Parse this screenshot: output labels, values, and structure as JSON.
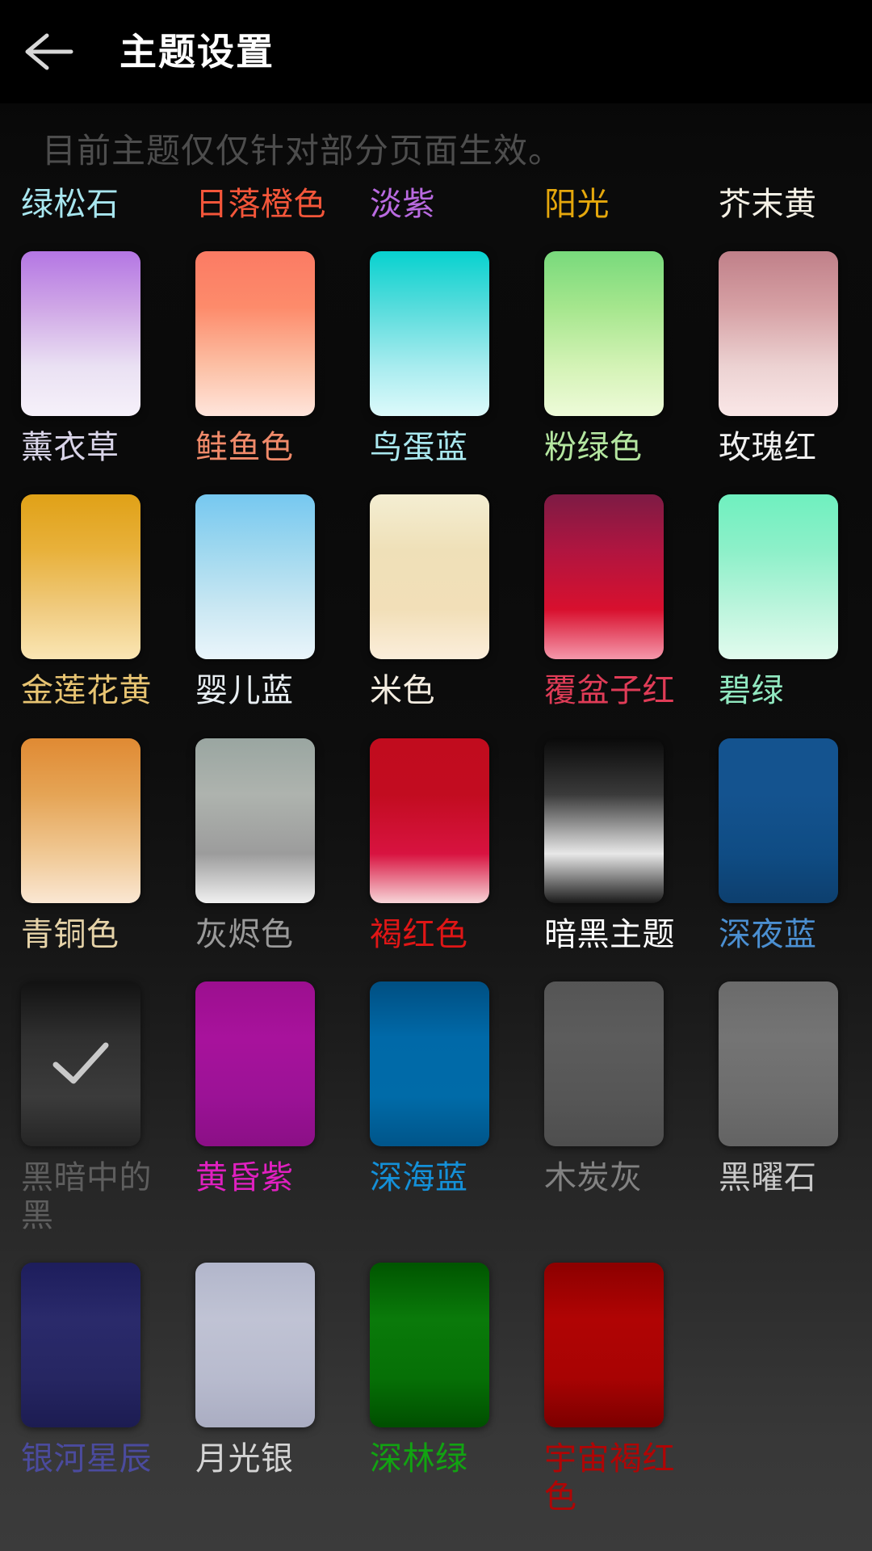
{
  "appbar": {
    "back_icon": "arrow-left-icon",
    "title": "主题设置"
  },
  "notice": "目前主题仅仅针对部分页面生效。",
  "selected_theme": "黑暗中的黑",
  "check_icon": "check-icon",
  "themes": [
    {
      "name": "绿松石",
      "label_color": "#a8e6ef",
      "swatch": null,
      "has_swatch": false,
      "selected": false
    },
    {
      "name": "日落橙色",
      "label_color": "#f4563a",
      "swatch": null,
      "has_swatch": false,
      "selected": false
    },
    {
      "name": "淡紫",
      "label_color": "#b96ae0",
      "swatch": null,
      "has_swatch": false,
      "selected": false
    },
    {
      "name": "阳光",
      "label_color": "#e5a70c",
      "swatch": null,
      "has_swatch": false,
      "selected": false
    },
    {
      "name": "芥末黄",
      "label_color": "#f5f1e6",
      "swatch": null,
      "has_swatch": false,
      "selected": false
    },
    {
      "name": "薰衣草",
      "label_color": "#d9d4e8",
      "swatch": [
        "#b476e4",
        "#cfa6e6",
        "#eae1f3",
        "#f6f1fa"
      ],
      "has_swatch": true,
      "selected": false
    },
    {
      "name": "鲑鱼色",
      "label_color": "#f08a6a",
      "swatch": [
        "#fb7b64",
        "#fd8b6b",
        "#fcc0a5",
        "#ffe5dc"
      ],
      "has_swatch": true,
      "selected": false
    },
    {
      "name": "鸟蛋蓝",
      "label_color": "#a9e8ef",
      "swatch": [
        "#07d2cf",
        "#56dcdc",
        "#a8ecef",
        "#ddfafb"
      ],
      "has_swatch": true,
      "selected": false
    },
    {
      "name": "粉绿色",
      "label_color": "#b4e6a0",
      "swatch": [
        "#78da7c",
        "#a5e68d",
        "#d4f3b6",
        "#eefbd9"
      ],
      "has_swatch": true,
      "selected": false
    },
    {
      "name": "玫瑰红",
      "label_color": "#f0f0f0",
      "swatch": [
        "#c08089",
        "#d6a0a4",
        "#ecd2d2",
        "#fae7e7"
      ],
      "has_swatch": true,
      "selected": false
    },
    {
      "name": "金莲花黄",
      "label_color": "#e8c472",
      "swatch": [
        "#e0a117",
        "#e8b13b",
        "#f0cb80",
        "#fae6b4"
      ],
      "has_swatch": true,
      "selected": false
    },
    {
      "name": "婴儿蓝",
      "label_color": "#e8eef2",
      "swatch": [
        "#76c8f0",
        "#9fd8ef",
        "#cbe8f3",
        "#eaf5fb"
      ],
      "has_swatch": true,
      "selected": false
    },
    {
      "name": "米色",
      "label_color": "#f3ece0",
      "swatch": [
        "#f4eed2",
        "#efe0b8",
        "#f2dfb8",
        "#fbeedb"
      ],
      "has_swatch": true,
      "selected": false
    },
    {
      "name": "覆盆子红",
      "label_color": "#e03c57",
      "swatch": [
        "#7d1b44",
        "#b01540",
        "#d8102e",
        "#f598ab"
      ],
      "has_swatch": true,
      "selected": false
    },
    {
      "name": "碧绿",
      "label_color": "#91e8c0",
      "swatch": [
        "#6ff0bf",
        "#8df0c9",
        "#bdf5dd",
        "#e2fbee"
      ],
      "has_swatch": true,
      "selected": false
    },
    {
      "name": "青铜色",
      "label_color": "#e6d3a8",
      "swatch": [
        "#e08a33",
        "#e5a455",
        "#f0c894",
        "#fae7d3"
      ],
      "has_swatch": true,
      "selected": false
    },
    {
      "name": "灰烬色",
      "label_color": "#9a9a9a",
      "swatch": [
        "#9aa6a1",
        "#aeb3ae",
        "#9c9c9c",
        "#f0f0f0"
      ],
      "has_swatch": true,
      "selected": false
    },
    {
      "name": "褐红色",
      "label_color": "#e01616",
      "swatch": [
        "#c10c1e",
        "#c20c20",
        "#d81340",
        "#f7d5d8"
      ],
      "has_swatch": true,
      "selected": false
    },
    {
      "name": "暗黑主题",
      "label_color": "#ffffff",
      "swatch": [
        "#0a0a0a",
        "#3a3a3a",
        "#e8e8e8",
        "#1a1a1a"
      ],
      "has_swatch": true,
      "selected": false
    },
    {
      "name": "深夜蓝",
      "label_color": "#4b8fd1",
      "swatch": [
        "#14538f",
        "#14538f",
        "#0f4c84",
        "#0d3f6e"
      ],
      "has_swatch": true,
      "selected": false
    },
    {
      "name": "黑暗中的黑",
      "label_color": "#5e5e5e",
      "swatch": [
        "#121212",
        "#2f2f2f",
        "#3b3b3b",
        "#252525"
      ],
      "has_swatch": true,
      "selected": true
    },
    {
      "name": "黄昏紫",
      "label_color": "#e020c0",
      "swatch": [
        "#9c0f8f",
        "#a8129c",
        "#9b1296",
        "#8b0f86"
      ],
      "has_swatch": true,
      "selected": false
    },
    {
      "name": "深海蓝",
      "label_color": "#1490d8",
      "swatch": [
        "#004f82",
        "#0069a8",
        "#006ba8",
        "#00558a"
      ],
      "has_swatch": true,
      "selected": false
    },
    {
      "name": "木炭灰",
      "label_color": "#828282",
      "swatch": [
        "#555555",
        "#5c5c5c",
        "#565656",
        "#4e4e4e"
      ],
      "has_swatch": true,
      "selected": false
    },
    {
      "name": "黑曜石",
      "label_color": "#c8c8c8",
      "swatch": [
        "#6b6b6b",
        "#747474",
        "#6d6d6d",
        "#636363"
      ],
      "has_swatch": true,
      "selected": false
    },
    {
      "name": "银河星辰",
      "label_color": "#4b4b9e",
      "swatch": [
        "#1d1d5c",
        "#2a2a6b",
        "#262662",
        "#1c1c52"
      ],
      "has_swatch": true,
      "selected": false
    },
    {
      "name": "月光银",
      "label_color": "#d4d4d4",
      "swatch": [
        "#b2b6cb",
        "#c0c3d4",
        "#b8bbce",
        "#aaadc2"
      ],
      "has_swatch": true,
      "selected": false
    },
    {
      "name": "深林绿",
      "label_color": "#11a311",
      "swatch": [
        "#005500",
        "#0a7a0a",
        "#067006",
        "#004f00"
      ],
      "has_swatch": true,
      "selected": false
    },
    {
      "name": "宇宙褐红色",
      "label_color": "#b00505",
      "swatch": [
        "#8c0000",
        "#b00404",
        "#a80303",
        "#7c0000"
      ],
      "has_swatch": true,
      "selected": false
    }
  ]
}
